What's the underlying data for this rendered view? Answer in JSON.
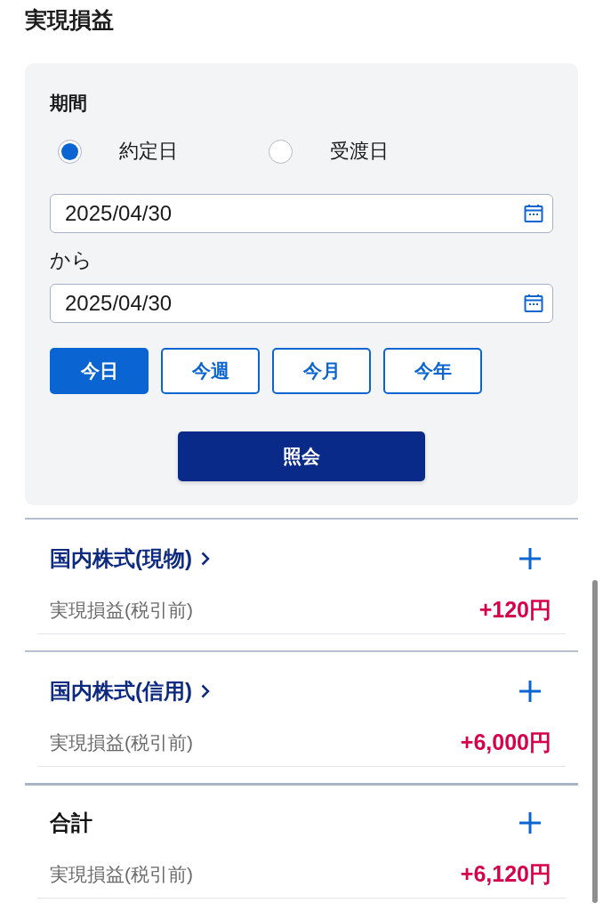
{
  "title": "実現損益",
  "filter": {
    "period_label": "期間",
    "date_basis": [
      {
        "label": "約定日",
        "selected": true
      },
      {
        "label": "受渡日",
        "selected": false
      }
    ],
    "from_date": {
      "value": "2025/04/30"
    },
    "from_label": "から",
    "to_date": {
      "value": "2025/04/30"
    },
    "quick_ranges": [
      {
        "label": "今日",
        "selected": true
      },
      {
        "label": "今週",
        "selected": false
      },
      {
        "label": "今月",
        "selected": false
      },
      {
        "label": "今年",
        "selected": false
      }
    ],
    "submit_button": "照会"
  },
  "sections": [
    {
      "kind": "category",
      "title": "国内株式(現物)",
      "expanded": false,
      "rows": [
        {
          "label": "実現損益(税引前)",
          "value": "+120円"
        }
      ]
    },
    {
      "kind": "category",
      "title": "国内株式(信用)",
      "expanded": false,
      "rows": [
        {
          "label": "実現損益(税引前)",
          "value": "+6,000円"
        }
      ]
    },
    {
      "kind": "total",
      "title": "合計",
      "expanded": false,
      "rows": [
        {
          "label": "実現損益(税引前)",
          "value": "+6,120円"
        }
      ]
    }
  ]
}
